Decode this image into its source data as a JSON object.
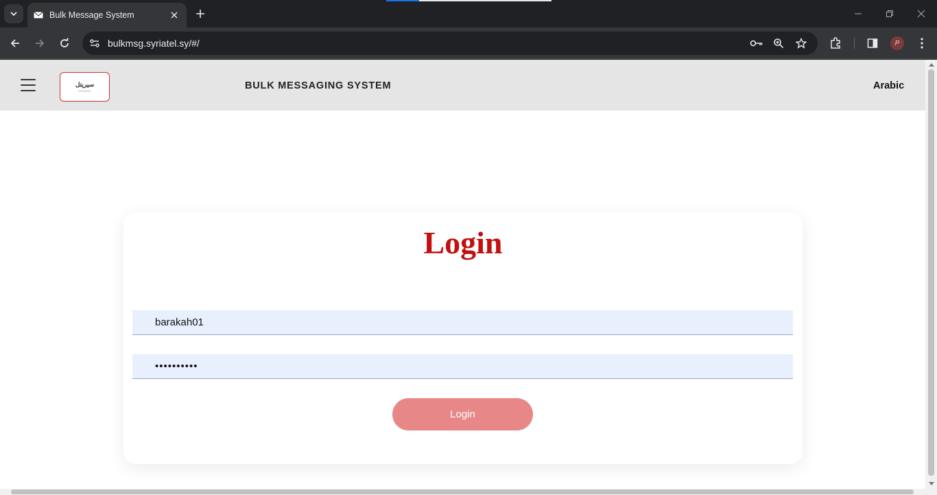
{
  "browser": {
    "tab_title": "Bulk Message System",
    "url": "bulkmsg.syriatel.sy/#/",
    "profile_initial": "P"
  },
  "header": {
    "logo_text": "سيريتل",
    "logo_subtext": "SYRIATEL",
    "title": "BULK MESSAGING SYSTEM",
    "language_link": "Arabic"
  },
  "login": {
    "title": "Login",
    "username_value": "barakah01",
    "password_value": "••••••••••",
    "button_label": "Login"
  },
  "colors": {
    "title_red": "#c40f0f",
    "button": "#e88787",
    "input_bg": "#e8f0fe",
    "header_bg": "#e5e5e5"
  }
}
